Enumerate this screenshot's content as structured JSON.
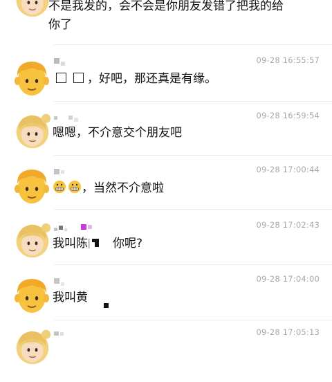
{
  "first_message": {
    "line1": "不是我发的，会不会是你朋友发错了把我的给",
    "line2": "你了"
  },
  "messages": [
    {
      "time": "09-28 16:55:57",
      "text": "，好吧，那还真是有缘。",
      "avatar": "man-face-emoji"
    },
    {
      "time": "09-28 16:59:54",
      "text": "嗯嗯，不介意交个朋友吧",
      "avatar": "blonde-woman-face-emoji"
    },
    {
      "time": "09-28 17:00:44",
      "text": "，当然不介意啦",
      "avatar": "man-face-emoji"
    },
    {
      "time": "09-28 17:02:43",
      "text_a": "我叫陈",
      "text_b": "你呢?",
      "avatar": "blonde-woman-face-emoji"
    },
    {
      "time": "09-28 17:04:00",
      "text": "我叫黄",
      "avatar": "man-face-emoji"
    },
    {
      "time": "09-28 17:05:13",
      "avatar": "blonde-woman-face-emoji"
    }
  ],
  "colors": {
    "background": "#ffffff",
    "timestamp": "#a9a9a9",
    "separator": "#ededed",
    "emoji_skin": "#f7c33f",
    "emoji_hair_woman": "#f1d27a",
    "redaction_purple": "#c93ad8"
  }
}
